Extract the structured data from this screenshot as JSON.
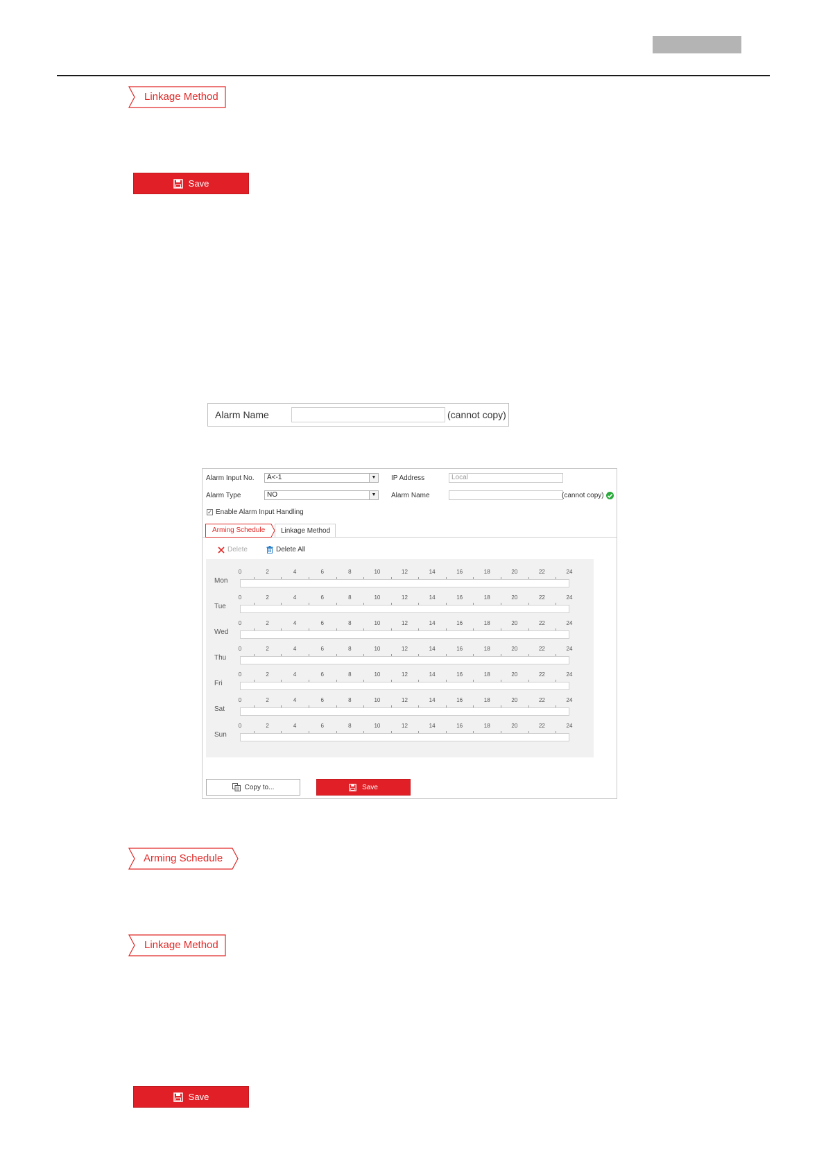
{
  "header": {},
  "sections": {
    "linkage_label_1": "Linkage Method",
    "save_1": "Save",
    "arming_label": "Arming Schedule",
    "linkage_label_2": "Linkage Method",
    "save_2": "Save"
  },
  "alarm_name_snippet": {
    "label": "Alarm Name",
    "value": "",
    "note": "(cannot copy)"
  },
  "panel": {
    "alarm_input_no_label": "Alarm Input No.",
    "alarm_input_no_value": "A<-1",
    "ip_address_label": "IP Address",
    "ip_address_value": "Local",
    "alarm_type_label": "Alarm Type",
    "alarm_type_value": "NO",
    "alarm_name_label": "Alarm Name",
    "alarm_name_value": "",
    "cannot_copy": "(cannot copy)",
    "enable_label": "Enable Alarm Input Handling",
    "enable_checked": true,
    "tabs": [
      "Arming Schedule",
      "Linkage Method"
    ],
    "delete_label": "Delete",
    "delete_all_label": "Delete All",
    "days": [
      "Mon",
      "Tue",
      "Wed",
      "Thu",
      "Fri",
      "Sat",
      "Sun"
    ],
    "hour_ticks": [
      "0",
      "2",
      "4",
      "6",
      "8",
      "10",
      "12",
      "14",
      "16",
      "18",
      "20",
      "22",
      "24"
    ],
    "copy_to_label": "Copy to...",
    "save_label": "Save"
  },
  "colors": {
    "accent_red": "#e01f26",
    "ok_green": "#2aab3c",
    "delete_red": "#e02826",
    "trash_blue": "#2a7fc9"
  },
  "icons": {
    "save": "floppy-disk-icon",
    "delete": "x-icon",
    "delete_all": "trash-icon",
    "copy": "copy-icon",
    "ok": "check-circle-icon"
  }
}
